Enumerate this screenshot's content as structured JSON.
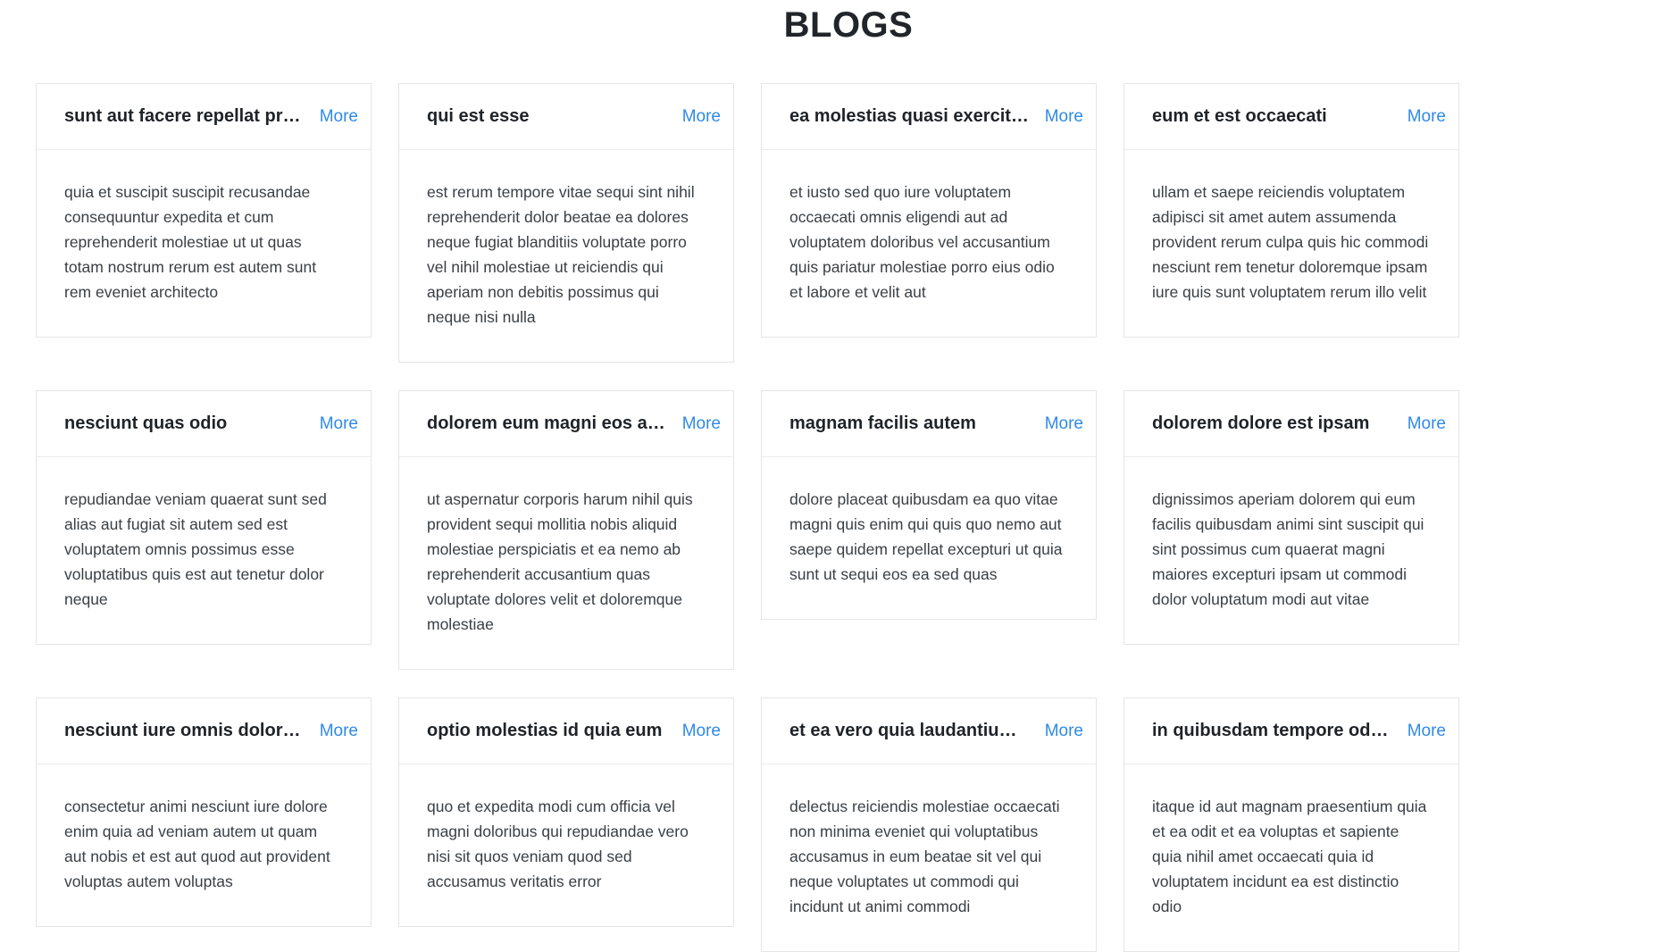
{
  "page": {
    "title": "BLOGS"
  },
  "more_label": "More",
  "posts": [
    {
      "title": "sunt aut facere repellat provident occaecati excepturi optio reprehenderit",
      "body": "quia et suscipit suscipit recusandae consequuntur expedita et cum reprehenderit molestiae ut ut quas totam nostrum rerum est autem sunt rem eveniet architecto"
    },
    {
      "title": "qui est esse",
      "body": "est rerum tempore vitae sequi sint nihil reprehenderit dolor beatae ea dolores neque fugiat blanditiis voluptate porro vel nihil molestiae ut reiciendis qui aperiam non debitis possimus qui neque nisi nulla"
    },
    {
      "title": "ea molestias quasi exercitationem repellat qui ipsa sit aut",
      "body": "et iusto sed quo iure voluptatem occaecati omnis eligendi aut ad voluptatem doloribus vel accusantium quis pariatur molestiae porro eius odio et labore et velit aut"
    },
    {
      "title": "eum et est occaecati",
      "body": "ullam et saepe reiciendis voluptatem adipisci sit amet autem assumenda provident rerum culpa quis hic commodi nesciunt rem tenetur doloremque ipsam iure quis sunt voluptatem rerum illo velit"
    },
    {
      "title": "nesciunt quas odio",
      "body": "repudiandae veniam quaerat sunt sed alias aut fugiat sit autem sed est voluptatem omnis possimus esse voluptatibus quis est aut tenetur dolor neque"
    },
    {
      "title": "dolorem eum magni eos aperiam quia",
      "body": "ut aspernatur corporis harum nihil quis provident sequi mollitia nobis aliquid molestiae perspiciatis et ea nemo ab reprehenderit accusantium quas voluptate dolores velit et doloremque molestiae"
    },
    {
      "title": "magnam facilis autem",
      "body": "dolore placeat quibusdam ea quo vitae magni quis enim qui quis quo nemo aut saepe quidem repellat excepturi ut quia sunt ut sequi eos ea sed quas"
    },
    {
      "title": "dolorem dolore est ipsam",
      "body": "dignissimos aperiam dolorem qui eum facilis quibusdam animi sint suscipit qui sint possimus cum quaerat magni maiores excepturi ipsam ut commodi dolor voluptatum modi aut vitae"
    },
    {
      "title": "nesciunt iure omnis dolorem tempora et accusantium",
      "body": "consectetur animi nesciunt iure dolore enim quia ad veniam autem ut quam aut nobis et est aut quod aut provident voluptas autem voluptas"
    },
    {
      "title": "optio molestias id quia eum",
      "body": "quo et expedita modi cum officia vel magni doloribus qui repudiandae vero nisi sit quos veniam quod sed accusamus veritatis error"
    },
    {
      "title": "et ea vero quia laudantium autem",
      "body": "delectus reiciendis molestiae occaecati non minima eveniet qui voluptatibus accusamus in eum beatae sit vel qui neque voluptates ut commodi qui incidunt ut animi commodi"
    },
    {
      "title": "in quibusdam tempore odit est dolorem",
      "body": "itaque id aut magnam praesentium quia et ea odit et ea voluptas et sapiente quia nihil amet occaecati quia id voluptatem incidunt ea est distinctio odio"
    }
  ]
}
